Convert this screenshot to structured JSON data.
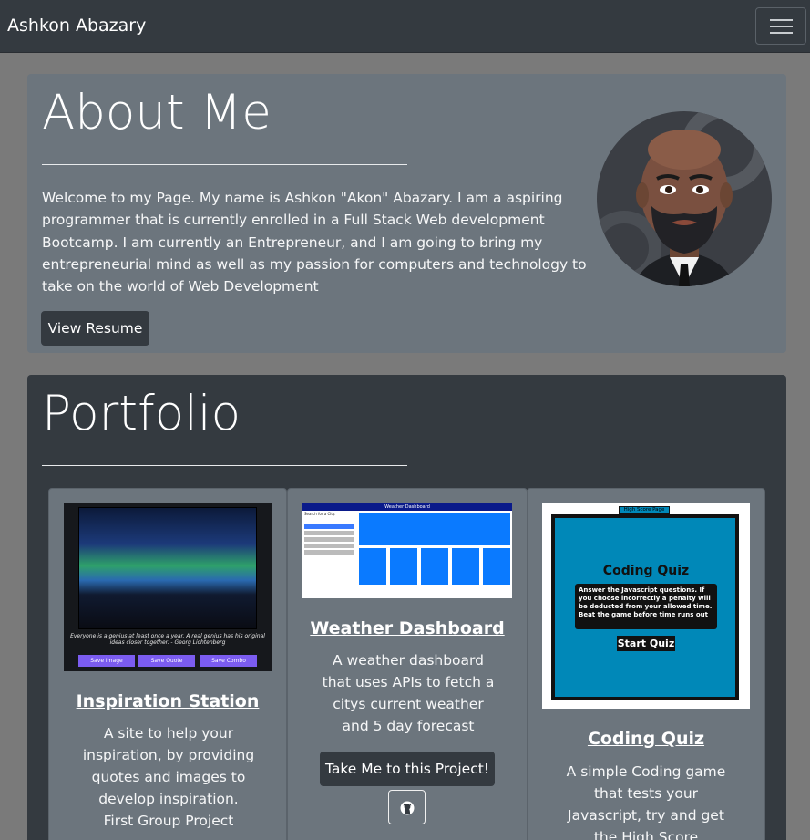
{
  "navbar": {
    "brand": "Ashkon Abazary",
    "menu_icon": "hamburger-icon"
  },
  "about": {
    "title": "About Me",
    "text": "Welcome to my Page. My name is Ashkon \"Akon\" Abazary. I am a aspiring programmer that is currently enrolled in a Full Stack Web development Bootcamp. I am currently an Entrepreneur, and I am going to bring my entrepreneurial mind as well as my passion for computers and technology to take on the world of Web Development",
    "button": "View Resume"
  },
  "portfolio": {
    "title": "Portfolio",
    "projects": [
      {
        "title": "Inspiration Station",
        "desc": "A site to help your inspiration, by providing quotes and images to develop inspiration. First Group Project",
        "thumb": {
          "quote": "Everyone is a genius at least once a year. A real genius has his original ideas closer together. - Georg Lichtenberg",
          "buttons": [
            "Save Image",
            "Save Quote",
            "Save Combo"
          ]
        }
      },
      {
        "title": "Weather Dashboard",
        "desc": "A weather dashboard that uses APIs to fetch a citys current weather and 5 day forecast",
        "button": "Take Me to this Project!",
        "github_icon": "github-icon",
        "thumb": {
          "header": "Weather Dashboard",
          "search_label": "Search for a City:"
        }
      },
      {
        "title": "Coding Quiz",
        "desc": "A simple Coding game that tests your Javascript, try and get the High Score",
        "thumb": {
          "high_score": "High Score Page",
          "title": "Coding Quiz",
          "body": "Answer the Javascript questions. If you choose incorrectly a penalty will be deducted from your allowed time. Beat the game before time runs out",
          "start": "Start Quiz"
        }
      }
    ]
  }
}
